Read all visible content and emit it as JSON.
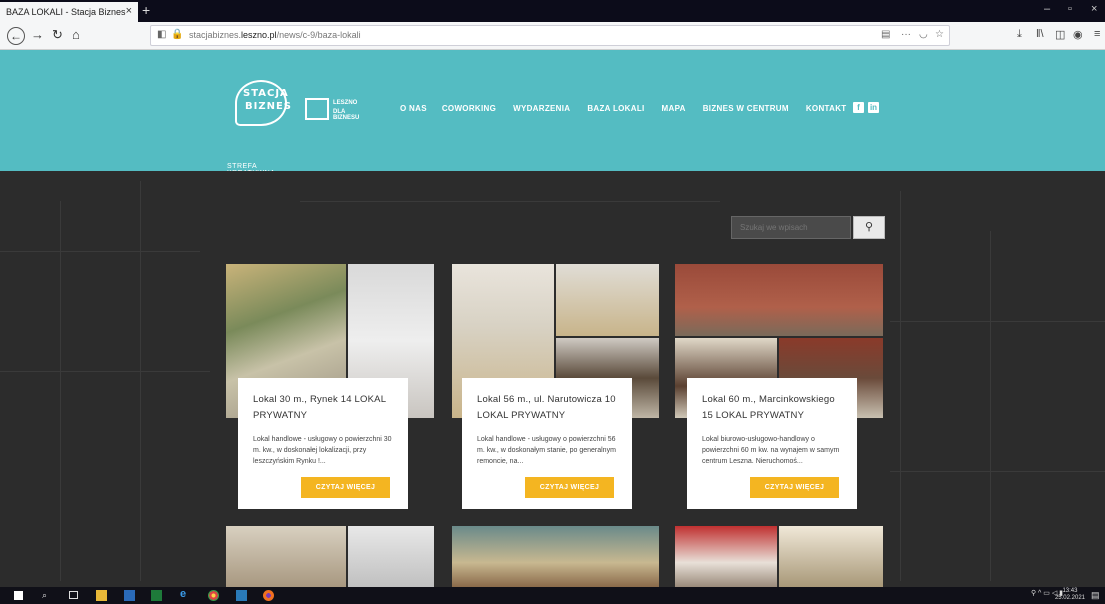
{
  "browser": {
    "tab_title": "BAZA LOKALI - Stacja Biznes",
    "tab_close": "×",
    "new_tab": "+",
    "url_plain_prefix": "stacjabiznes.",
    "url_domain": "leszno.pl",
    "url_path": "/news/c-9/baza-lokali",
    "page_actions": "···"
  },
  "site": {
    "logo_line1": "STACJA",
    "logo_line2": "BIZNES",
    "logo_tagline": "STREFA KREATYWNA",
    "partner_line1": "LESZNO",
    "partner_line2": "DLA BIZNESU",
    "menu": [
      "O NAS",
      "COWORKING",
      "WYDARZENIA",
      "BAZA LOKALI",
      "MAPA",
      "BIZNES W CENTRUM",
      "KONTAKT"
    ],
    "social": [
      "f",
      "in"
    ]
  },
  "search": {
    "placeholder": "Szukaj we wpisach"
  },
  "listings": [
    {
      "title": "Lokal 30 m., Rynek 14 LOKAL PRYWATNY",
      "description": "Lokal handlowe - usługowy o powierzchni 30 m. kw., w doskonałej lokalizacji, przy leszczyńskim Rynku !...",
      "button": "CZYTAJ WIĘCEJ"
    },
    {
      "title": "Lokal 56 m., ul. Narutowicza 10 LOKAL PRYWATNY",
      "description": "Lokal handlowe - usługowy o powierzchni 56 m. kw., w doskonałym stanie, po generalnym remoncie, na...",
      "button": "CZYTAJ WIĘCEJ"
    },
    {
      "title": "Lokal 60 m., Marcinkowskiego 15 LOKAL PRYWATNY",
      "description": "Lokal biurowo-usługowo-handlowy o powierzchni 60 m kw. na wynajem w samym centrum Leszna. Nieruchomoś...",
      "button": "CZYTAJ WIĘCEJ"
    }
  ],
  "taskbar": {
    "time": "13:43",
    "date": "25.02.2021"
  },
  "colors": {
    "header": "#54bcc2",
    "accent_button": "#f4b521",
    "background": "#2c2c2c"
  }
}
